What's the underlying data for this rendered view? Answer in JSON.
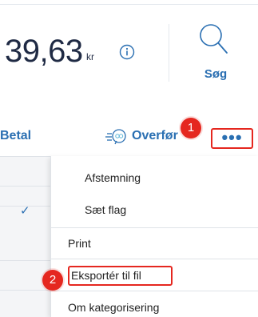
{
  "balance": {
    "amount": "39,63",
    "currency": "kr"
  },
  "search": {
    "label": "Søg"
  },
  "actions": {
    "pay_label": "Betal",
    "transfer_label": "Overfør",
    "more_label": "•••"
  },
  "markers": {
    "m1": "1",
    "m2": "2"
  },
  "menu": {
    "items": [
      {
        "label": "Afstemning",
        "checked": false
      },
      {
        "label": "Sæt flag",
        "checked": true
      },
      {
        "label": "Print",
        "checked": false
      },
      {
        "label": "Eksportér til fil",
        "checked": false
      },
      {
        "label": "Om kategorisering",
        "checked": false
      }
    ]
  },
  "colors": {
    "accent": "#2a6fb2",
    "marker": "#e5271f",
    "text": "#1f2a44"
  }
}
